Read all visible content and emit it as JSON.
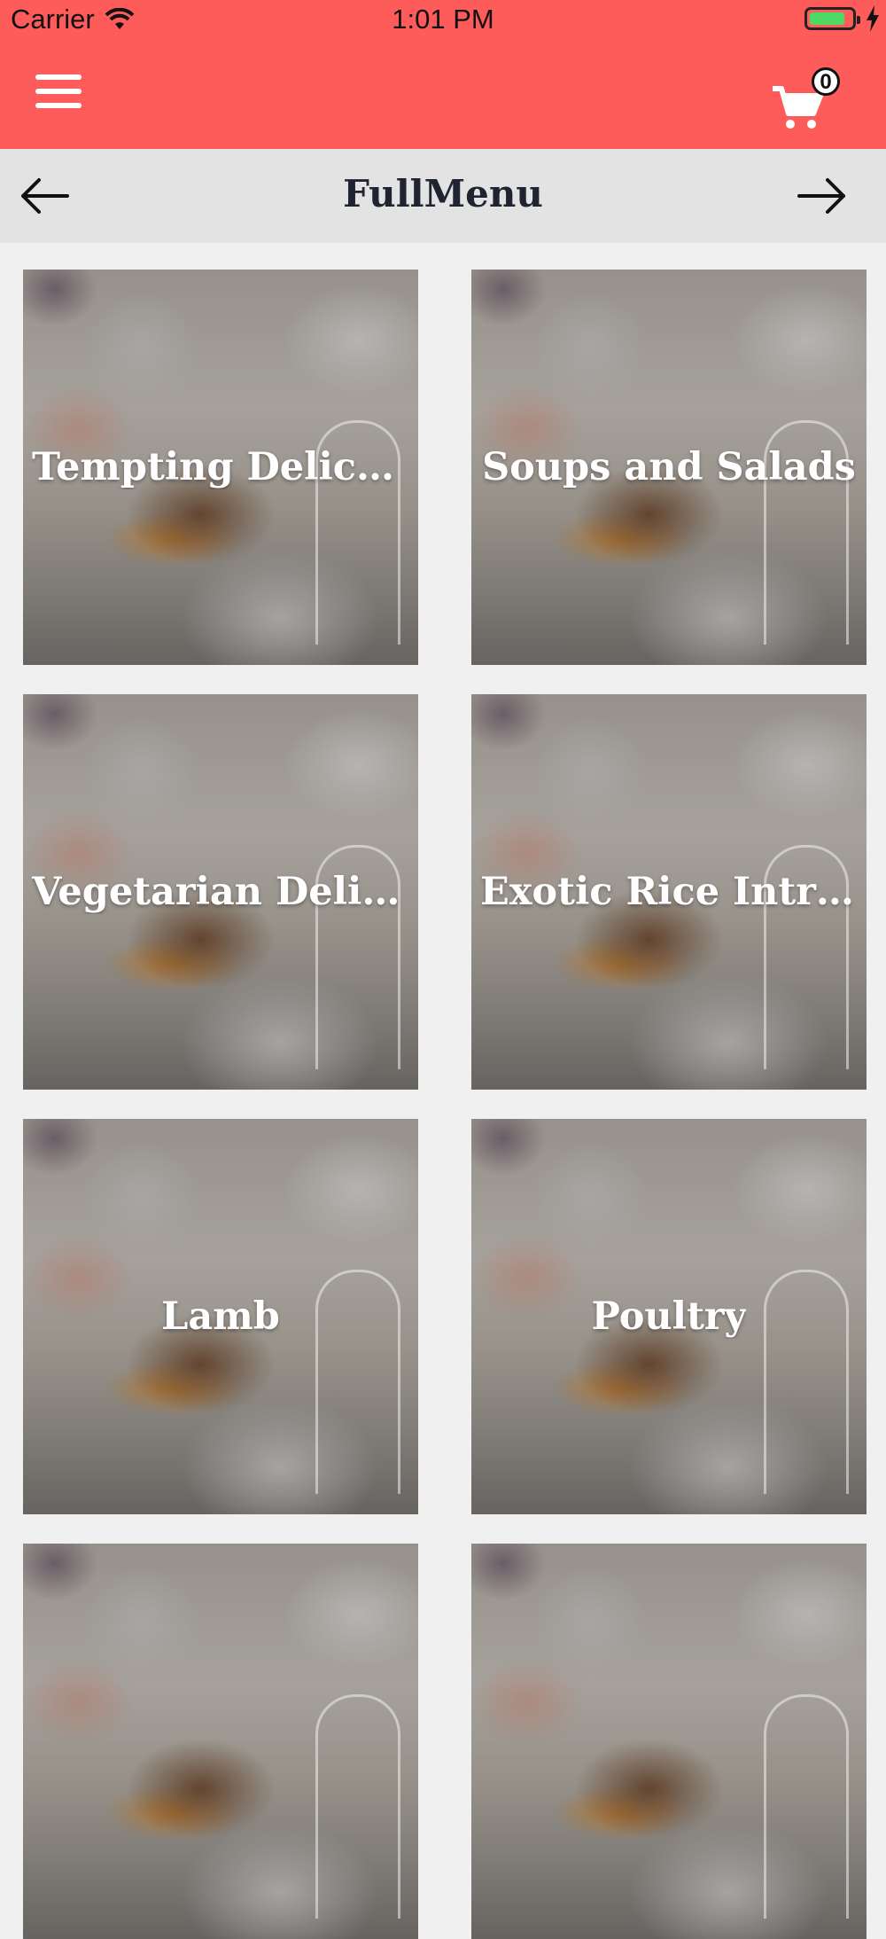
{
  "status_bar": {
    "carrier": "Carrier",
    "time": "1:01 PM",
    "battery_level": 0.85
  },
  "header": {
    "menu_icon": "hamburger-menu-icon",
    "cart_icon": "shopping-cart-icon",
    "cart_count": "0",
    "accent_color": "#fe5b5b"
  },
  "nav": {
    "title": "FullMenu",
    "back_icon": "arrow-left-icon",
    "forward_icon": "arrow-right-icon"
  },
  "categories": [
    {
      "label": "Tempting Delicac..."
    },
    {
      "label": "Soups and Salads"
    },
    {
      "label": "Vegetarian Deligh..."
    },
    {
      "label": "Exotic Rice Intro..."
    },
    {
      "label": "Lamb"
    },
    {
      "label": "Poultry"
    }
  ]
}
